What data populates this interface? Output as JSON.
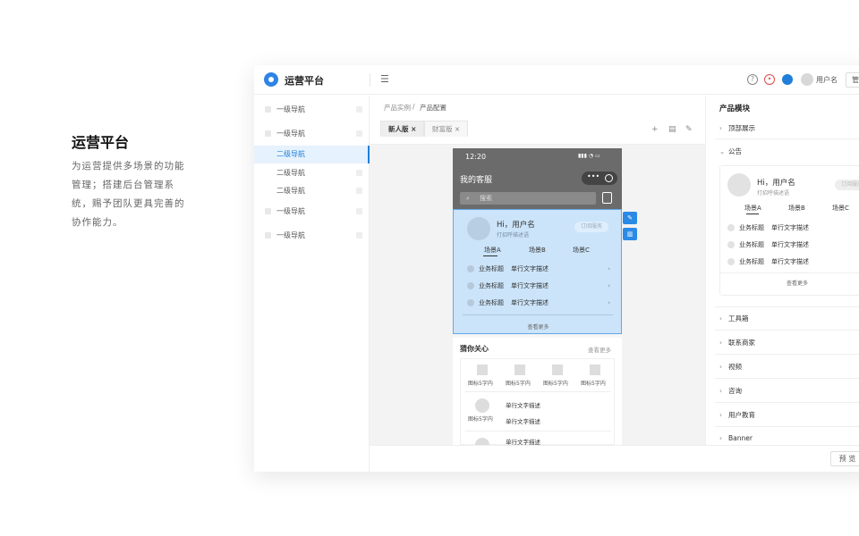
{
  "intro": {
    "title": "运营平台",
    "desc": "为运营提供多场景的功能管理；搭建后台管理系统，赐予团队更具完善的协作能力。"
  },
  "app": {
    "name": "运营平台",
    "menu_toggle": "☰",
    "user": "用户名",
    "top_button": "管"
  },
  "sidebar": {
    "items": [
      {
        "label": "一级导航"
      },
      {
        "label": "一级导航"
      },
      {
        "label": "二级导航"
      },
      {
        "label": "二级导航"
      },
      {
        "label": "二级导航"
      },
      {
        "label": "一级导航"
      },
      {
        "label": "一级导航"
      }
    ]
  },
  "breadcrumb": {
    "first": "产品实例",
    "sep": "/",
    "second": "产品配置"
  },
  "tabs": [
    {
      "label": "新人版",
      "close": "×"
    },
    {
      "label": "财富版",
      "close": "×"
    }
  ],
  "phone": {
    "time": "12:20",
    "status_icons": "▮▮▮ ◔ ▭",
    "title": "我的客服",
    "search_placeholder": "搜索",
    "greeting": "Hi，用户名",
    "greeting_sub": "打招呼描述语",
    "pill": "订阅服务",
    "scenes": [
      "场景A",
      "场景B",
      "场景C"
    ],
    "rows": [
      {
        "title": "业务标题",
        "desc": "单行文字描述"
      },
      {
        "title": "业务标题",
        "desc": "单行文字描述"
      },
      {
        "title": "业务标题",
        "desc": "单行文字描述"
      }
    ],
    "more": "查看更多",
    "guess_title": "猜你关心",
    "guess_more": "查看更多",
    "grid": [
      "图标5字内",
      "图标5字内",
      "图标5字内",
      "图标5字内"
    ],
    "list_icon_label": "图标5字内",
    "list_lines": [
      "单行文字描述",
      "单行文字描述",
      "单行文字描述"
    ]
  },
  "right_panel": {
    "title": "产品模块",
    "modules_top": [
      {
        "label": "顶部展示",
        "chevron": "›"
      },
      {
        "label": "公告",
        "chevron": "⌄"
      }
    ],
    "preview": {
      "greeting": "Hi，用户名",
      "sub": "打招呼描述语",
      "pill": "订阅服务",
      "scenes": [
        "场景A",
        "场景B",
        "场景C"
      ],
      "rows": [
        {
          "title": "业务标题",
          "desc": "单行文字描述"
        },
        {
          "title": "业务标题",
          "desc": "单行文字描述"
        },
        {
          "title": "业务标题",
          "desc": "单行文字描述"
        }
      ],
      "more": "查看更多"
    },
    "modules_bottom": [
      {
        "label": "工具箱",
        "chevron": "›"
      },
      {
        "label": "联系商家",
        "chevron": "›"
      },
      {
        "label": "视频",
        "chevron": "›"
      },
      {
        "label": "咨询",
        "chevron": "›"
      },
      {
        "label": "用户教育",
        "chevron": "›"
      },
      {
        "label": "Banner",
        "chevron": "›"
      }
    ]
  },
  "footer": {
    "preview_button": "预 览"
  },
  "colors": {
    "accent": "#1f7fd9",
    "selected_bg": "#cbe4f9",
    "phone_header": "#6b6b6b"
  }
}
